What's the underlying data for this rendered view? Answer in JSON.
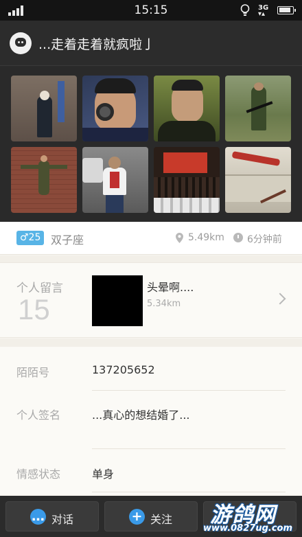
{
  "status_bar": {
    "time": "15:15",
    "network": "3G",
    "icons": [
      "signal-icon",
      "bulb-icon",
      "3g-icon",
      "battery-charging-icon"
    ]
  },
  "header": {
    "icon": "chat-bubble-icon",
    "title": "...走着走着就疯啦亅"
  },
  "photos": [
    {
      "name": "photo-1",
      "bg": "#6d5f55"
    },
    {
      "name": "photo-2",
      "bg": "#3b4a6e"
    },
    {
      "name": "photo-3",
      "bg": "#5a6a3a"
    },
    {
      "name": "photo-4",
      "bg": "#7b8a5a"
    },
    {
      "name": "photo-5",
      "bg": "#8a4a3a"
    },
    {
      "name": "photo-6",
      "bg": "#6a6a6a"
    },
    {
      "name": "photo-7",
      "bg": "#3a2a22"
    },
    {
      "name": "photo-8",
      "bg": "#c9c4b6"
    }
  ],
  "profile": {
    "gender_age": "♂25",
    "zodiac": "双子座",
    "distance": "5.49km",
    "last_seen": "6分钟前",
    "colors": {
      "gender_badge": "#58b4e6"
    }
  },
  "message": {
    "label": "个人留言",
    "count": "15",
    "title": "头晕啊....",
    "distance": "5.34km"
  },
  "details": {
    "momo_id_label": "陌陌号",
    "momo_id": "137205652",
    "signature_label": "个人签名",
    "signature": "...真心的想结婚了...",
    "relationship_label": "情感状态",
    "relationship": "单身"
  },
  "bottom_bar": {
    "chat_label": "对话",
    "follow_label": "关注",
    "colors": {
      "icon": "#3a9ae8"
    }
  },
  "watermark": {
    "brand": "游鸽网",
    "url": "www.0827ug.com"
  }
}
